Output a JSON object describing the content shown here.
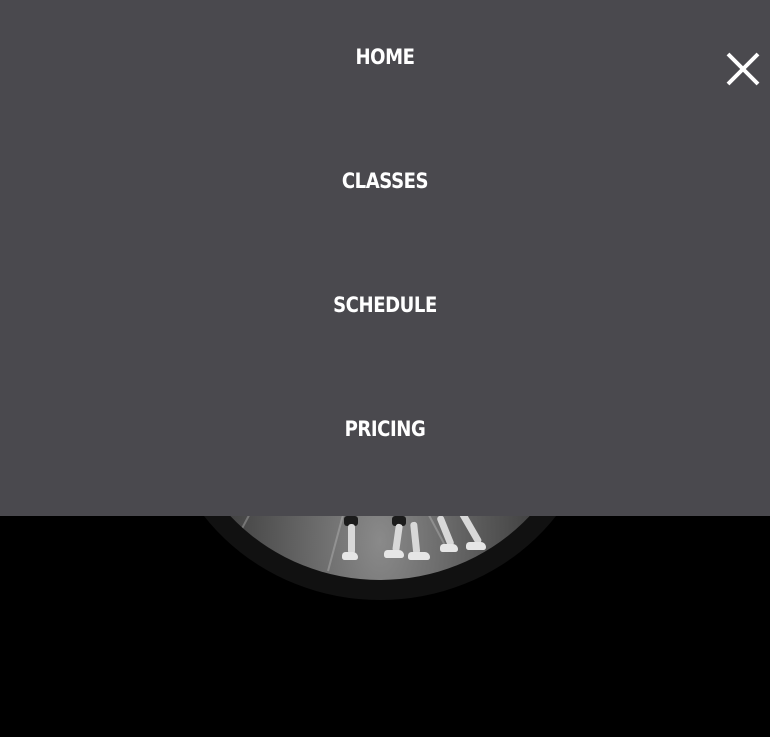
{
  "menu": {
    "items": [
      {
        "label": "HOME"
      },
      {
        "label": "CLASSES"
      },
      {
        "label": "SCHEDULE"
      },
      {
        "label": "PRICING"
      }
    ],
    "close_icon": "close-icon",
    "background_color": "#4a494e",
    "text_color": "#ffffff"
  },
  "page": {
    "background_color": "#000000"
  }
}
